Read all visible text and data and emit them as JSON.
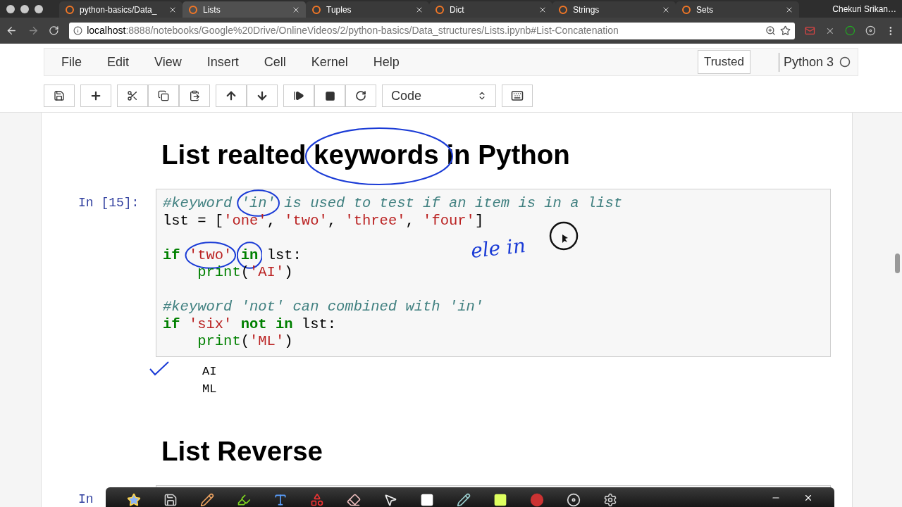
{
  "browser": {
    "tabs": [
      {
        "title": "python-basics/Data_",
        "selected": false
      },
      {
        "title": "Lists",
        "selected": true
      },
      {
        "title": "Tuples",
        "selected": false
      },
      {
        "title": "Dict",
        "selected": false
      },
      {
        "title": "Strings",
        "selected": false
      },
      {
        "title": "Sets",
        "selected": false
      }
    ],
    "profile": "Chekuri Srikan…",
    "address": {
      "host": "localhost",
      "rest": ":8888/notebooks/Google%20Drive/OnlineVideos/2/python-basics/Data_structures/Lists.ipynb#List-Concatenation"
    }
  },
  "notebook": {
    "menu": [
      "File",
      "Edit",
      "View",
      "Insert",
      "Cell",
      "Kernel",
      "Help"
    ],
    "trusted": "Trusted",
    "kernel": "Python 3",
    "cell_type": "Code"
  },
  "cells": [
    {
      "kind": "heading",
      "text": "List realted keywords in Python"
    },
    {
      "kind": "code",
      "prompt": "In [15]:",
      "lines": [
        {
          "kind": "code",
          "tokens": [
            {
              "t": "#keyword",
              "kind": "comment"
            },
            {
              "t": "'in'",
              "kind": "comment",
              "space": true,
              "circled": true
            },
            {
              "t": "is used to test if an item is in a list",
              "kind": "comment",
              "space": true
            }
          ]
        },
        {
          "kind": "code",
          "tokens": [
            {
              "t": "lst = [",
              "kind": "plain"
            },
            {
              "t": "'one'",
              "kind": "string"
            },
            {
              "t": ",",
              "kind": "plain"
            },
            {
              "t": "'two'",
              "kind": "string",
              "space": true
            },
            {
              "t": ",",
              "kind": "plain"
            },
            {
              "t": "'three'",
              "kind": "string",
              "space": true
            },
            {
              "t": ",",
              "kind": "plain"
            },
            {
              "t": "'four'",
              "kind": "string",
              "space": true
            },
            {
              "t": "]",
              "kind": "plain"
            }
          ]
        },
        {
          "kind": "blank"
        },
        {
          "kind": "code",
          "tokens": [
            {
              "t": "if",
              "kind": "keyword"
            },
            {
              "t": "'two'",
              "kind": "string",
              "space": true,
              "circled": true
            },
            {
              "t": "in",
              "kind": "keyword",
              "space": true,
              "circled": true
            },
            {
              "t": "lst:",
              "kind": "plain",
              "space": true
            }
          ]
        },
        {
          "kind": "code",
          "indented": true,
          "tokens": [
            {
              "t": "print",
              "kind": "builtin"
            },
            {
              "t": "(",
              "kind": "plain"
            },
            {
              "t": "'AI'",
              "kind": "string"
            },
            {
              "t": ")",
              "kind": "plain"
            }
          ]
        },
        {
          "kind": "blank"
        },
        {
          "kind": "code",
          "tokens": [
            {
              "t": "#keyword 'not' can combined with 'in'",
              "kind": "comment"
            }
          ]
        },
        {
          "kind": "code",
          "tokens": [
            {
              "t": "if",
              "kind": "keyword"
            },
            {
              "t": "'six'",
              "kind": "string",
              "space": true
            },
            {
              "t": "not",
              "kind": "keyword",
              "space": true
            },
            {
              "t": "in",
              "kind": "keyword",
              "space": true
            },
            {
              "t": "lst:",
              "kind": "plain",
              "space": true
            }
          ]
        },
        {
          "kind": "code",
          "indented": true,
          "tokens": [
            {
              "t": "print",
              "kind": "builtin"
            },
            {
              "t": "(",
              "kind": "plain"
            },
            {
              "t": "'ML'",
              "kind": "string"
            },
            {
              "t": ")",
              "kind": "plain"
            }
          ]
        }
      ],
      "outputs": [
        "AI",
        "ML"
      ]
    },
    {
      "kind": "heading",
      "text": "List Reverse"
    },
    {
      "kind": "code",
      "prompt": "In"
    }
  ],
  "annotation": {
    "handwriting": "ele in"
  }
}
